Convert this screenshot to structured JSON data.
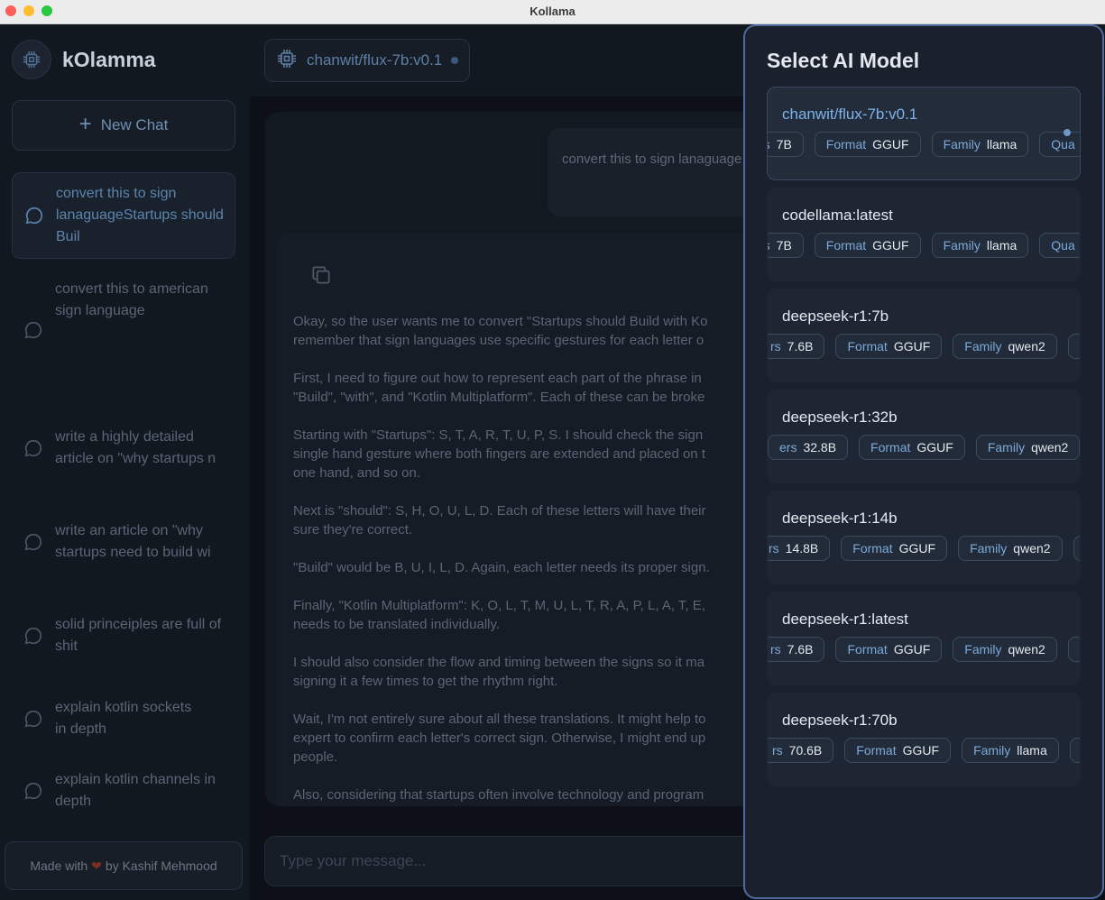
{
  "window": {
    "title": "Kollama"
  },
  "brand": {
    "name": "kOlamma"
  },
  "sidebar": {
    "new_chat_label": "New Chat",
    "chats": [
      {
        "label": "convert this to sign lanaguageStartups should Buil",
        "active": true
      },
      {
        "label": "convert this to american sign language",
        "active": false
      },
      {
        "label": "write a highly detailed article on \"why startups n",
        "active": false
      },
      {
        "label": "write an article on \"why startups need to build wi",
        "active": false
      },
      {
        "label": "solid princeiples are full of shit",
        "active": false
      },
      {
        "label": "explain kotlin sockets\n in depth",
        "active": false
      },
      {
        "label": "explain kotlin channels in depth",
        "active": false
      }
    ],
    "credit": {
      "prefix": "Made with",
      "suffix": "by Kashif Mehmood"
    }
  },
  "topbar": {
    "current_model": "chanwit/flux-7b:v0.1"
  },
  "chat": {
    "user_message": "convert this to sign lanaguage",
    "ai_paragraphs": [
      [
        "Okay, so the user wants me to convert \"Startups should Build with Ko",
        "remember that sign languages use specific gestures for each letter o"
      ],
      [
        "First, I need to figure out how to represent each part of the phrase in",
        "\"Build\", \"with\", and \"Kotlin Multiplatform\". Each of these can be broke"
      ],
      [
        "Starting with \"Startups\": S, T, A, R, T, U, P, S. I should check the sign",
        "single hand gesture where both fingers are extended and placed on t",
        "one hand, and so on."
      ],
      [
        "Next is \"should\": S, H, O, U, L, D. Each of these letters will have their",
        "sure they're correct."
      ],
      [
        "\"Build\" would be B, U, I, L, D. Again, each letter needs its proper sign."
      ],
      [
        "Finally, \"Kotlin Multiplatform\": K, O, L, T, M, U, L, T, R, A, P, L, A, T, E,",
        "needs to be translated individually."
      ],
      [
        "I should also consider the flow and timing between the signs so it ma",
        "signing it a few times to get the rhythm right."
      ],
      [
        "Wait, I'm not entirely sure about all these translations. It might help to",
        "expert to confirm each letter's correct sign. Otherwise, I might end up",
        "people."
      ],
      [
        "Also, considering that startups often involve technology and program"
      ]
    ],
    "input_placeholder": "Type your message..."
  },
  "model_panel": {
    "title": "Select AI Model",
    "models": [
      {
        "name": "chanwit/flux-7b:v0.1",
        "selected": true,
        "params_key": "rs",
        "params": "7B",
        "format": "GGUF",
        "family": "llama",
        "extra_key": "Qua"
      },
      {
        "name": "codellama:latest",
        "selected": false,
        "params_key": "rs",
        "params": "7B",
        "format": "GGUF",
        "family": "llama",
        "extra_key": "Qua"
      },
      {
        "name": "deepseek-r1:7b",
        "selected": false,
        "params_key": "rs",
        "params": "7.6B",
        "format": "GGUF",
        "family": "qwen2",
        "extra_key": ""
      },
      {
        "name": "deepseek-r1:32b",
        "selected": false,
        "params_key": "ers",
        "params": "32.8B",
        "format": "GGUF",
        "family": "qwen2",
        "extra_key": ""
      },
      {
        "name": "deepseek-r1:14b",
        "selected": false,
        "params_key": "rs",
        "params": "14.8B",
        "format": "GGUF",
        "family": "qwen2",
        "extra_key": ""
      },
      {
        "name": "deepseek-r1:latest",
        "selected": false,
        "params_key": "rs",
        "params": "7.6B",
        "format": "GGUF",
        "family": "qwen2",
        "extra_key": ""
      },
      {
        "name": "deepseek-r1:70b",
        "selected": false,
        "params_key": "rs",
        "params": "70.6B",
        "format": "GGUF",
        "family": "llama",
        "extra_key": ""
      }
    ],
    "labels": {
      "format": "Format",
      "family": "Family"
    }
  }
}
